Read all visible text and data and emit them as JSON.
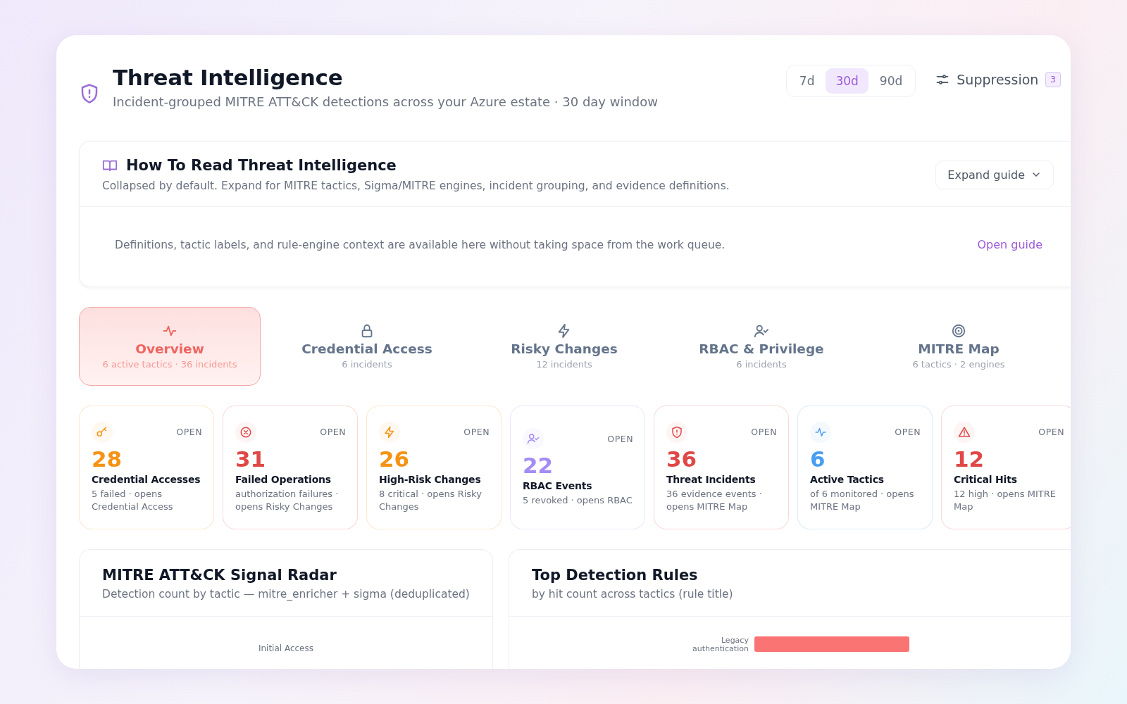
{
  "header": {
    "title": "Threat Intelligence",
    "subtitle": "Incident-grouped MITRE ATT&CK detections across your Azure estate · 30 day window"
  },
  "ranges": [
    {
      "label": "7d",
      "selected": false
    },
    {
      "label": "30d",
      "selected": true
    },
    {
      "label": "90d",
      "selected": false
    }
  ],
  "suppression": {
    "label": "Suppression",
    "count": "3"
  },
  "guide": {
    "title": "How To Read Threat Intelligence",
    "description": "Collapsed by default. Expand for MITRE tactics, Sigma/MITRE engines, incident grouping, and evidence definitions.",
    "expand_button": "Expand guide",
    "expanded": false,
    "body": "Definitions, tactic labels, and rule-engine context are available here without taking space from the work queue.",
    "link": "Open guide"
  },
  "tabs": [
    {
      "kind": "pulse",
      "label": "Overview",
      "caption": "6 active tactics · 36 incidents",
      "selected": true
    },
    {
      "kind": "lock",
      "label": "Credential Access",
      "caption": "6 incidents",
      "selected": false
    },
    {
      "kind": "bolt",
      "label": "Risky Changes",
      "caption": "12 incidents",
      "selected": false
    },
    {
      "kind": "user",
      "label": "RBAC & Privilege",
      "caption": "6 incidents",
      "selected": false
    },
    {
      "kind": "target",
      "label": "MITRE Map",
      "caption": "6 tactics · 2 engines",
      "selected": false
    }
  ],
  "stats": [
    {
      "kind": "key",
      "color": "#f59315",
      "value": "28",
      "title": "Credential Accesses",
      "detail": "5 failed · opens Credential Access",
      "status": "OPEN"
    },
    {
      "kind": "failure",
      "color": "#e04848",
      "value": "31",
      "title": "Failed Operations",
      "detail": "authorization failures · opens Risky Changes",
      "status": "OPEN"
    },
    {
      "kind": "bolt",
      "color": "#f59315",
      "value": "26",
      "title": "High-Risk Changes",
      "detail": "8 critical · opens Risky Changes",
      "status": "OPEN"
    },
    {
      "kind": "user",
      "color": "#a48cf5",
      "value": "22",
      "title": "RBAC Events",
      "detail": "5 revoked · opens RBAC",
      "status": "OPEN"
    },
    {
      "kind": "shield",
      "color": "#e04848",
      "value": "36",
      "title": "Threat Incidents",
      "detail": "36 evidence events · opens MITRE Map",
      "status": "OPEN"
    },
    {
      "kind": "pulse",
      "color": "#4a9ef2",
      "value": "6",
      "title": "Active Tactics",
      "detail": "of 6 monitored · opens MITRE Map",
      "status": "OPEN"
    },
    {
      "kind": "warning",
      "color": "#e04848",
      "value": "12",
      "title": "Critical Hits",
      "detail": "12 high · opens MITRE Map",
      "status": "OPEN"
    }
  ],
  "panels": [
    {
      "kind": "radar",
      "title": "MITRE ATT&CK Signal Radar",
      "subtitle": "Detection count by tactic — mitre_enricher + sigma (deduplicated)",
      "labels": [
        "Initial Access"
      ]
    },
    {
      "kind": "bars",
      "title": "Top Detection Rules",
      "subtitle": "by hit count across tactics (rule title)",
      "labels": [
        "Legacy authentication"
      ]
    }
  ]
}
